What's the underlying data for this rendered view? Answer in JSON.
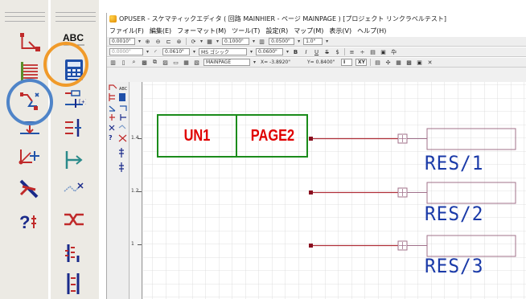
{
  "window": {
    "title": "OPUSER - スケマティックエディタ ( 回路 MAINHIER - ページ MAINPAGE ) [プロジェクト リンクラベルテスト]"
  },
  "menu": [
    "ファイル(F)",
    "編集(E)",
    "フォーマット(M)",
    "ツール(T)",
    "設定(R)",
    "マップ(M)",
    "表示(V)",
    "ヘルプ(H)"
  ],
  "toolbar1": {
    "grid": "0.0010\"",
    "snap": "0.1000\"",
    "pitch1": "0.0500\"",
    "pitch2": "1.0\""
  },
  "toolbar2": {
    "line_width": "0.0000\"",
    "arc": "0.0610\"",
    "font": "MS ゴシック",
    "font_size": "0.0600\"",
    "bold": "B",
    "italic": "I",
    "underline": "U",
    "strike": "S"
  },
  "toolbar3": {
    "page": "MAINPAGE",
    "x_coord": "X= -3.8920\"",
    "y_coord": "Y= 0.8400\"",
    "mode": "I",
    "axis": "XY"
  },
  "palette": {
    "abc_label": "ABC"
  },
  "ruler": {
    "labels": [
      "1.4",
      "1.2",
      "1"
    ]
  },
  "schematic": {
    "title_block": [
      "UN1",
      "PAGE2"
    ],
    "components": [
      "RES/1",
      "RES/2",
      "RES/3"
    ]
  },
  "colors": {
    "highlight_orange": "#f09a2a",
    "highlight_blue": "#4f84c8",
    "wire": "#b0303a",
    "grid": "#d8d8d8",
    "title_text": "#e00000",
    "title_border": "#1b8c1b",
    "component_text": "#1a3aa8"
  }
}
